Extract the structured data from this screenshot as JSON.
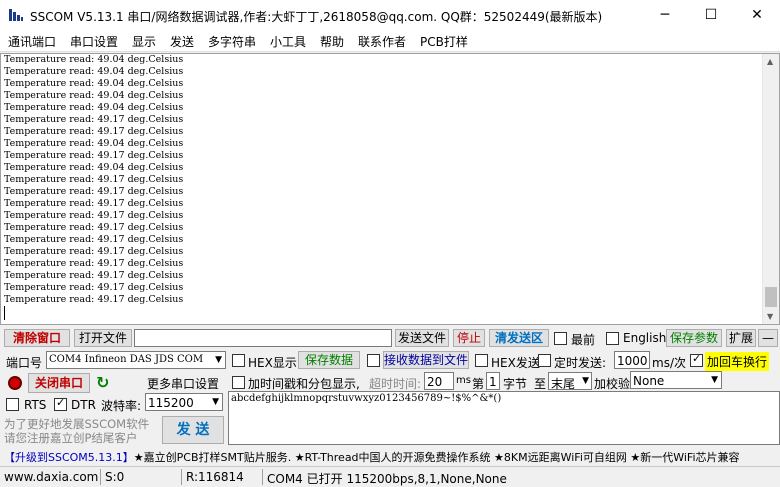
{
  "window": {
    "title": "SSCOM V5.13.1 串口/网络数据调试器,作者:大虾丁丁,2618058@qq.com. QQ群：52502449(最新版本)",
    "min": "─",
    "max": "☐",
    "close": "✕"
  },
  "menu": [
    "通讯端口",
    "串口设置",
    "显示",
    "发送",
    "多字符串",
    "小工具",
    "帮助",
    "联系作者",
    "PCB打样"
  ],
  "output": {
    "lines": [
      "Temperature read: 49.04 deg.Celsius",
      "Temperature read: 49.04 deg.Celsius",
      "Temperature read: 49.04 deg.Celsius",
      "Temperature read: 49.04 deg.Celsius",
      "Temperature read: 49.04 deg.Celsius",
      "Temperature read: 49.17 deg.Celsius",
      "Temperature read: 49.17 deg.Celsius",
      "Temperature read: 49.04 deg.Celsius",
      "Temperature read: 49.17 deg.Celsius",
      "Temperature read: 49.04 deg.Celsius",
      "Temperature read: 49.17 deg.Celsius",
      "Temperature read: 49.17 deg.Celsius",
      "Temperature read: 49.17 deg.Celsius",
      "Temperature read: 49.17 deg.Celsius",
      "Temperature read: 49.17 deg.Celsius",
      "Temperature read: 49.17 deg.Celsius",
      "Temperature read: 49.17 deg.Celsius",
      "Temperature read: 49.17 deg.Celsius",
      "Temperature read: 49.17 deg.Celsius",
      "Temperature read: 49.17 deg.Celsius",
      "Temperature read: 49.17 deg.Celsius"
    ]
  },
  "toolbar": {
    "clear": "清除窗口",
    "open_file": "打开文件",
    "send_file": "发送文件",
    "stop": "停止",
    "clear_send": "清发送区",
    "topmost": "最前",
    "english": "English",
    "save_params": "保存参数",
    "expand": "扩展",
    "collapse": "—"
  },
  "port": {
    "label": "端口号",
    "value": "COM4 Infineon DAS JDS COM",
    "hex_show": "HEX显示",
    "save_data": "保存数据",
    "recv_to_file": "接收数据到文件",
    "hex_send": "HEX发送",
    "timed_send": "定时发送:",
    "interval": "1000",
    "interval_unit": "ms/次",
    "add_crlf": "加回车换行"
  },
  "row3": {
    "close_port": "关闭串口",
    "more_settings": "更多串口设置",
    "timestamp": "加时间戳和分包显示,",
    "timeout_label": "超时时间:",
    "timeout": "20",
    "timeout_unit": "ms",
    "nth": "第",
    "byte_index": "1",
    "byte_unit": "字节",
    "to": "至",
    "tail": "末尾",
    "checksum": "加校验",
    "checksum_value": "None"
  },
  "row4": {
    "rts": "RTS",
    "dtr": "DTR",
    "baud_label": "波特率:",
    "baud": "115200"
  },
  "send": {
    "text": "abcdefghijklmnopqrstuvwxyz0123456789~!$%^&*()",
    "button": "发 送",
    "promo1": "为了更好地发展SSCOM软件",
    "promo2": "请您注册嘉立创P结尾客户"
  },
  "ticker": {
    "upgrade": "【升级到SSCOM5.13.1】",
    "rest": "★嘉立创PCB打样SMT贴片服务. ★RT-Thread中国人的开源免费操作系统 ★8KM远距离WiFi可自组网 ★新一代WiFi芯片兼容"
  },
  "status": {
    "site": "www.daxia.com",
    "sent": "S:0",
    "recv": "R:116814",
    "port_state": "COM4 已打开  115200bps,8,1,None,None"
  }
}
